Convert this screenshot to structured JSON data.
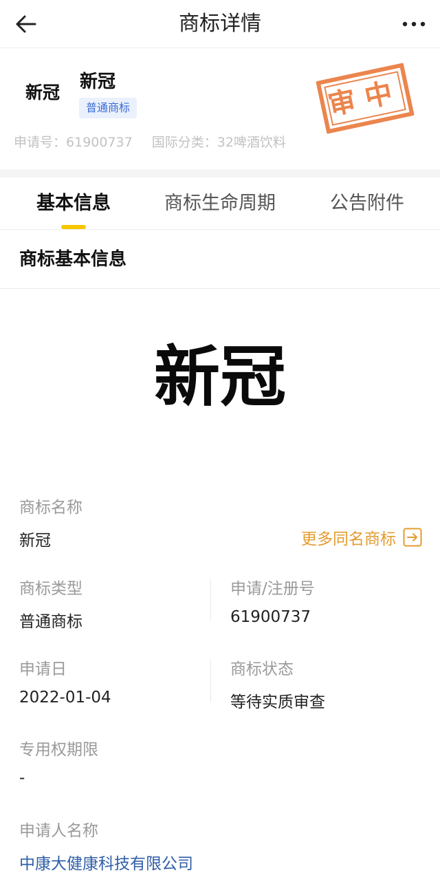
{
  "nav": {
    "title": "商标详情",
    "back_icon": "arrow-left-icon",
    "more_icon": "more-dots-icon"
  },
  "header": {
    "logo_text": "新冠",
    "name": "新冠",
    "type_badge": "普通商标",
    "application_no_label": "申请号：",
    "application_no": "61900737",
    "intl_class_label": "国际分类：",
    "intl_class": "32啤酒饮料",
    "stamp_text": "审中"
  },
  "tabs": [
    {
      "label": "基本信息",
      "active": true
    },
    {
      "label": "商标生命周期",
      "active": false
    },
    {
      "label": "公告附件",
      "active": false
    }
  ],
  "section": {
    "title": "商标基本信息"
  },
  "mark_image_text": "新冠",
  "fields": {
    "name_label": "商标名称",
    "name_value": "新冠",
    "more_same_name": "更多同名商标",
    "type_label": "商标类型",
    "type_value": "普通商标",
    "reg_no_label": "申请/注册号",
    "reg_no_value": "61900737",
    "apply_date_label": "申请日",
    "apply_date_value": "2022-01-04",
    "status_label": "商标状态",
    "status_value": "等待实质审查",
    "exclusive_period_label": "专用权期限",
    "exclusive_period_value": "-",
    "applicant_label": "申请人名称",
    "applicant_value": "中康大健康科技有限公司"
  },
  "colors": {
    "accent_yellow": "#f6c600",
    "stamp_orange": "#e9783a",
    "link_orange": "#e39b2f",
    "link_blue": "#2f5ea8",
    "badge_blue": "#3a6bd1"
  }
}
